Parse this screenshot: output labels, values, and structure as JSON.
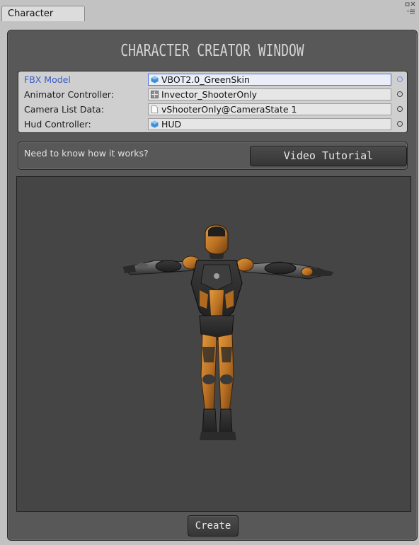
{
  "tab": {
    "title": "Character"
  },
  "window_controls": {
    "icons": [
      "maximize-icon",
      "close-icon",
      "menu-icon"
    ]
  },
  "panel": {
    "title": "CHARACTER CREATOR WINDOW"
  },
  "fields": [
    {
      "label": "FBX Model",
      "value": "VBOT2.0_GreenSkin",
      "icon": "model-cube-icon",
      "selected": true
    },
    {
      "label": "Animator Controller:",
      "value": "Invector_ShooterOnly",
      "icon": "animator-controller-icon",
      "selected": false
    },
    {
      "label": "Camera List Data:",
      "value": "vShooterOnly@CameraState 1",
      "icon": "document-icon",
      "selected": false
    },
    {
      "label": "Hud Controller:",
      "value": "HUD",
      "icon": "prefab-cube-icon",
      "selected": false
    }
  ],
  "help": {
    "text": "Need to know how it works?",
    "button_label": "Video Tutorial"
  },
  "preview": {
    "subject": "character-model"
  },
  "actions": {
    "create_label": "Create"
  },
  "colors": {
    "panel_bg": "#585858",
    "preview_bg": "#454545",
    "active_label": "#3a5cc8",
    "character_orange": "#c07a2a"
  }
}
